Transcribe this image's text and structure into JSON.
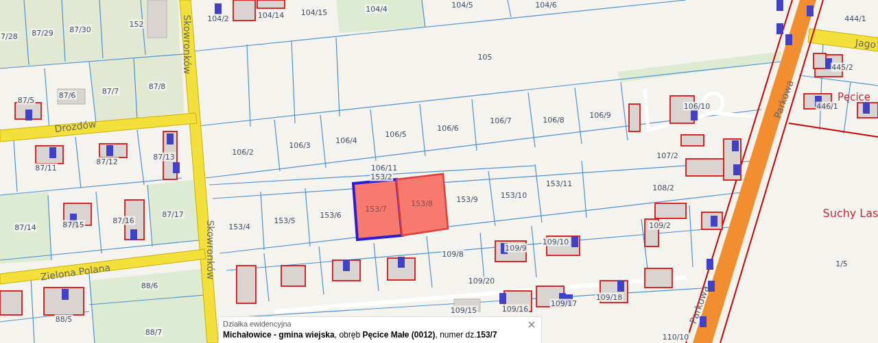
{
  "map": {
    "parcels": [
      "7/28",
      "87/29",
      "87/30",
      "152",
      "104/2",
      "104/14",
      "104/15",
      "104/4",
      "104/5",
      "104/6",
      "105",
      "87/5",
      "87/6",
      "87/7",
      "87/8",
      "87/11",
      "87/12",
      "87/13",
      "106/2",
      "106/3",
      "106/4",
      "106/5",
      "106/6",
      "106/7",
      "106/8",
      "106/9",
      "106/10",
      "106/11",
      "153/2",
      "107/2",
      "108/2",
      "153/4",
      "153/5",
      "153/6",
      "153/9",
      "153/10",
      "153/11",
      "87/14",
      "87/15",
      "87/16",
      "87/17",
      "109/2",
      "109/8",
      "109/9",
      "109/10",
      "109/20",
      "109/18",
      "109/16",
      "109/15",
      "109/17",
      "88/6",
      "88/5",
      "88/7",
      "110/10",
      "1/5",
      "444/1",
      "445/2",
      "446/1"
    ],
    "highlighted_parcels": [
      {
        "label": "153/7",
        "selected": true
      },
      {
        "label": "153/8",
        "selected": false
      }
    ],
    "streets": [
      "Skowronków",
      "Skowronków",
      "Drozdów",
      "Zielona Polana",
      "Parkowa",
      "Parkowa",
      "Jago"
    ],
    "places": [
      "Pęcice",
      "Suchy Las"
    ]
  },
  "info_popup": {
    "title": "Działka ewidencyjna",
    "text": "**Michałowice - gmina wiejska**, obręb **Pęcice Małe (0012)**, numer dz.**153/7**"
  }
}
